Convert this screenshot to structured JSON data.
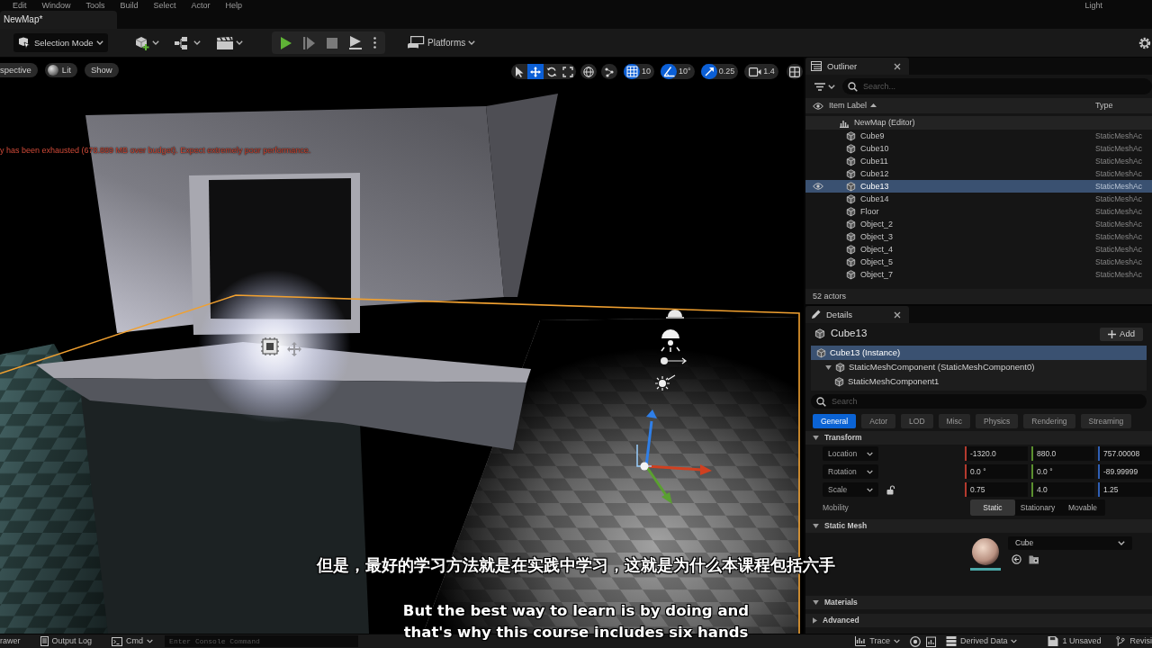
{
  "menu_bar": {
    "items": [
      "Edit",
      "Window",
      "Tools",
      "Build",
      "Select",
      "Actor",
      "Help"
    ],
    "right_label": "Light"
  },
  "document_tab": {
    "title": "NewMap*"
  },
  "main_toolbar": {
    "mode_button": "Selection Mode",
    "platforms_button": "Platforms"
  },
  "viewport": {
    "view_buttons": [
      {
        "kind": "view",
        "label": "spective"
      },
      {
        "kind": "lit",
        "label": "Lit"
      },
      {
        "kind": "show",
        "label": "Show"
      }
    ],
    "transform_tools": [
      {
        "kind": "select",
        "selected": false
      },
      {
        "kind": "translate",
        "selected": true
      },
      {
        "kind": "rotate",
        "selected": false
      },
      {
        "kind": "scale",
        "selected": false
      }
    ],
    "snaps": [
      {
        "kind": "grid",
        "on": true,
        "reading": "10"
      },
      {
        "kind": "rotation",
        "on": true,
        "reading": "10°"
      },
      {
        "kind": "scale",
        "on": true,
        "reading": "0.25"
      },
      {
        "kind": "camera",
        "reading": "1.4"
      }
    ],
    "warning": "y has been exhausted (678.889 MB over budget). Expect extremely poor performance."
  },
  "outliner": {
    "title": "Outliner",
    "search_placeholder": "Search...",
    "columns": [
      "Item Label",
      "Type"
    ],
    "tree": {
      "label": "NewMap (Editor)",
      "children": [
        {
          "label": "Cube9",
          "type": "StaticMeshAc",
          "selected": false
        },
        {
          "label": "Cube10",
          "type": "StaticMeshAc",
          "selected": false
        },
        {
          "label": "Cube11",
          "type": "StaticMeshAc",
          "selected": false
        },
        {
          "label": "Cube12",
          "type": "StaticMeshAc",
          "selected": false
        },
        {
          "label": "Cube13",
          "type": "StaticMeshAc",
          "selected": true
        },
        {
          "label": "Cube14",
          "type": "StaticMeshAc",
          "selected": false
        },
        {
          "label": "Floor",
          "type": "StaticMeshAc",
          "selected": false
        },
        {
          "label": "Object_2",
          "type": "StaticMeshAc",
          "selected": false
        },
        {
          "label": "Object_3",
          "type": "StaticMeshAc",
          "selected": false
        },
        {
          "label": "Object_4",
          "type": "StaticMeshAc",
          "selected": false
        },
        {
          "label": "Object_5",
          "type": "StaticMeshAc",
          "selected": false
        },
        {
          "label": "Object_7",
          "type": "StaticMeshAc",
          "selected": false
        }
      ]
    },
    "footer": "52 actors"
  },
  "details": {
    "title": "Details",
    "actor_name": "Cube13",
    "add_button": "Add",
    "components": [
      {
        "label": "Cube13 (Instance)",
        "selected": true,
        "children": [
          {
            "label": "StaticMeshComponent (StaticMeshComponent0)",
            "selected": false,
            "expanded": true,
            "children": [
              {
                "label": "StaticMeshComponent1",
                "selected": false
              }
            ]
          }
        ]
      }
    ],
    "search_placeholder": "Search",
    "categories": [
      {
        "label": "General",
        "selected": true
      },
      {
        "label": "Actor",
        "selected": false
      },
      {
        "label": "LOD",
        "selected": false
      },
      {
        "label": "Misc",
        "selected": false
      },
      {
        "label": "Physics",
        "selected": false
      },
      {
        "label": "Rendering",
        "selected": false
      },
      {
        "label": "Streaming",
        "selected": false
      }
    ],
    "sections": [
      {
        "kind": "transform",
        "title": "Transform",
        "expanded": true,
        "properties": [
          {
            "label": "Location",
            "values": [
              "-1320.0",
              "880.0",
              "757.00008"
            ]
          },
          {
            "label": "Rotation",
            "values": [
              "0.0 °",
              "0.0 °",
              "-89.99999"
            ]
          },
          {
            "label": "Scale",
            "locked": false,
            "values": [
              "0.75",
              "4.0",
              "1.25"
            ]
          }
        ],
        "mobility": {
          "label": "Mobility",
          "options": [
            {
              "label": "Static",
              "selected": true
            },
            {
              "label": "Stationary",
              "selected": false
            },
            {
              "label": "Movable",
              "selected": false
            }
          ]
        }
      },
      {
        "kind": "mesh",
        "title": "Static Mesh",
        "expanded": true,
        "mesh": "Cube"
      },
      {
        "kind": "plain",
        "title": "Materials",
        "expanded": true
      },
      {
        "kind": "plain",
        "title": "Advanced",
        "expanded": false
      }
    ]
  },
  "status_bar": {
    "left": [
      {
        "kind": "drawer",
        "label": "rawer"
      },
      {
        "kind": "log",
        "label": "Output Log"
      },
      {
        "kind": "cmd",
        "label": "Cmd"
      }
    ],
    "console_placeholder": "Enter Console Command",
    "right": [
      {
        "kind": "trace",
        "label": "Trace"
      },
      {
        "kind": "derived",
        "label": "Derived Data"
      },
      {
        "kind": "unsaved",
        "label": "1 Unsaved"
      },
      {
        "kind": "revision",
        "label": "Revisi"
      }
    ]
  },
  "subtitles": [
    "但是，最好的学习方法就是在实践中学习，这就是为什么本课程包括六手",
    "But the best way to learn is by doing and",
    "that's why this course includes six hands"
  ]
}
